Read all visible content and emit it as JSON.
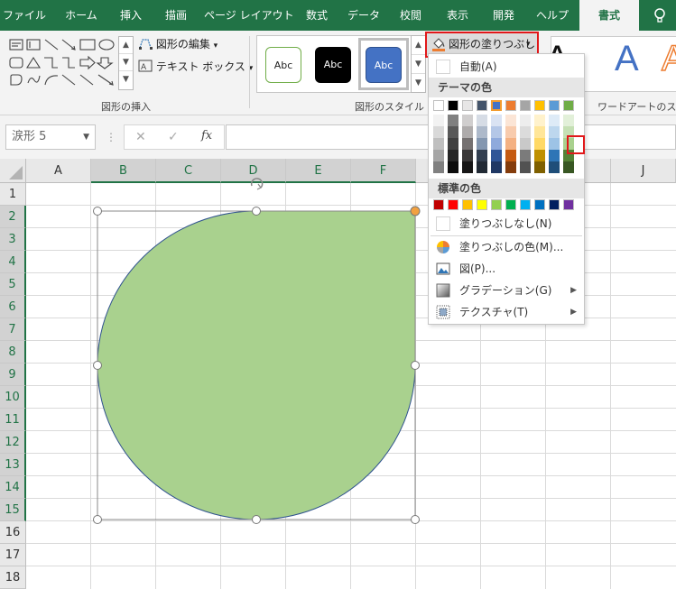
{
  "tabs": [
    "ファイル",
    "ホーム",
    "挿入",
    "描画",
    "ページ レイアウト",
    "数式",
    "データ",
    "校閲",
    "表示",
    "開発",
    "ヘルプ",
    "書式"
  ],
  "ribbon": {
    "edit_shape": "図形の編集",
    "text_box": "テキスト ボックス",
    "insert_shapes_label": "図形の挿入",
    "abc": "Abc",
    "shape_styles_label": "図形のスタイル",
    "fill_button": "図形の塗りつぶし",
    "wordart_label": "ワードアートのスタイ",
    "wordart_glyph": "A"
  },
  "formula_bar": {
    "name_box": "涙形 5",
    "cancel": "✕",
    "enter": "✓",
    "fx": "fx"
  },
  "columns": [
    "A",
    "B",
    "C",
    "D",
    "E",
    "F",
    "",
    "",
    "",
    "J"
  ],
  "rows": [
    "1",
    "2",
    "3",
    "4",
    "5",
    "6",
    "7",
    "8",
    "9",
    "10",
    "11",
    "12",
    "13",
    "14",
    "15",
    "16",
    "17",
    "18"
  ],
  "menu": {
    "auto": "自動(A)",
    "theme_colors": "テーマの色",
    "standard_colors": "標準の色",
    "no_fill": "塗りつぶしなし(N)",
    "more_colors": "塗りつぶしの色(M)...",
    "picture": "図(P)...",
    "gradient": "グラデーション(G)",
    "texture": "テクスチャ(T)",
    "submenu_arrow": "▶"
  },
  "colors": {
    "excel_green": "#217346",
    "shape_fill": "#a9d18e",
    "shape_outline": "#2f528f",
    "highlight": "#e1181a",
    "theme_top": [
      "#ffffff",
      "#000000",
      "#e7e6e6",
      "#44546a",
      "#4472c4",
      "#ed7d31",
      "#a5a5a5",
      "#ffc000",
      "#5b9bd5",
      "#70ad47"
    ],
    "theme_shades": [
      [
        "#f2f2f2",
        "#d9d9d9",
        "#bfbfbf",
        "#a6a6a6",
        "#808080"
      ],
      [
        "#808080",
        "#595959",
        "#404040",
        "#262626",
        "#0d0d0d"
      ],
      [
        "#d0cece",
        "#aeabab",
        "#757171",
        "#3a3838",
        "#171616"
      ],
      [
        "#d6dce5",
        "#adb9ca",
        "#8497b0",
        "#333f50",
        "#222a35"
      ],
      [
        "#dae3f3",
        "#b4c7e7",
        "#8faadc",
        "#2f5597",
        "#203864"
      ],
      [
        "#fbe5d6",
        "#f8cbad",
        "#f4b183",
        "#c55a11",
        "#843c0c"
      ],
      [
        "#ededed",
        "#dbdbdb",
        "#c9c9c9",
        "#7b7b7b",
        "#525252"
      ],
      [
        "#fff2cc",
        "#ffe699",
        "#ffd966",
        "#bf9000",
        "#7f6000"
      ],
      [
        "#deebf7",
        "#bdd7ee",
        "#9dc3e6",
        "#2e75b6",
        "#1f4e79"
      ],
      [
        "#e2f0d9",
        "#c5e0b4",
        "#a9d18e",
        "#548235",
        "#385723"
      ]
    ],
    "standard": [
      "#c00000",
      "#ff0000",
      "#ffc000",
      "#ffff00",
      "#92d050",
      "#00b050",
      "#00b0f0",
      "#0070c0",
      "#002060",
      "#7030a0"
    ]
  }
}
